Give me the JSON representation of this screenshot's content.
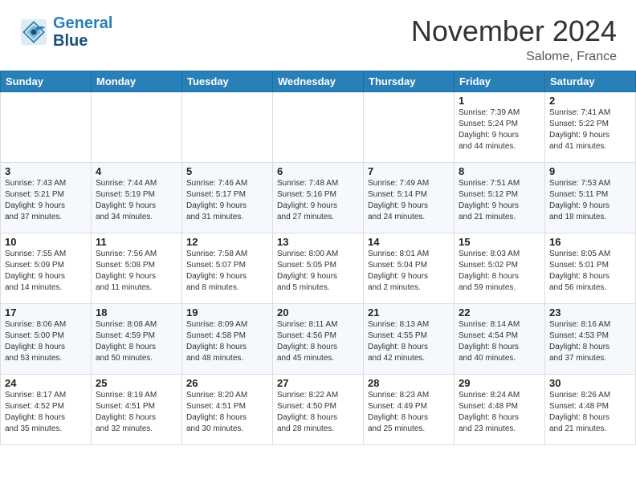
{
  "header": {
    "logo_line1": "General",
    "logo_line2": "Blue",
    "month": "November 2024",
    "location": "Salome, France"
  },
  "weekdays": [
    "Sunday",
    "Monday",
    "Tuesday",
    "Wednesday",
    "Thursday",
    "Friday",
    "Saturday"
  ],
  "weeks": [
    [
      {
        "day": "",
        "info": ""
      },
      {
        "day": "",
        "info": ""
      },
      {
        "day": "",
        "info": ""
      },
      {
        "day": "",
        "info": ""
      },
      {
        "day": "",
        "info": ""
      },
      {
        "day": "1",
        "info": "Sunrise: 7:39 AM\nSunset: 5:24 PM\nDaylight: 9 hours\nand 44 minutes."
      },
      {
        "day": "2",
        "info": "Sunrise: 7:41 AM\nSunset: 5:22 PM\nDaylight: 9 hours\nand 41 minutes."
      }
    ],
    [
      {
        "day": "3",
        "info": "Sunrise: 7:43 AM\nSunset: 5:21 PM\nDaylight: 9 hours\nand 37 minutes."
      },
      {
        "day": "4",
        "info": "Sunrise: 7:44 AM\nSunset: 5:19 PM\nDaylight: 9 hours\nand 34 minutes."
      },
      {
        "day": "5",
        "info": "Sunrise: 7:46 AM\nSunset: 5:17 PM\nDaylight: 9 hours\nand 31 minutes."
      },
      {
        "day": "6",
        "info": "Sunrise: 7:48 AM\nSunset: 5:16 PM\nDaylight: 9 hours\nand 27 minutes."
      },
      {
        "day": "7",
        "info": "Sunrise: 7:49 AM\nSunset: 5:14 PM\nDaylight: 9 hours\nand 24 minutes."
      },
      {
        "day": "8",
        "info": "Sunrise: 7:51 AM\nSunset: 5:12 PM\nDaylight: 9 hours\nand 21 minutes."
      },
      {
        "day": "9",
        "info": "Sunrise: 7:53 AM\nSunset: 5:11 PM\nDaylight: 9 hours\nand 18 minutes."
      }
    ],
    [
      {
        "day": "10",
        "info": "Sunrise: 7:55 AM\nSunset: 5:09 PM\nDaylight: 9 hours\nand 14 minutes."
      },
      {
        "day": "11",
        "info": "Sunrise: 7:56 AM\nSunset: 5:08 PM\nDaylight: 9 hours\nand 11 minutes."
      },
      {
        "day": "12",
        "info": "Sunrise: 7:58 AM\nSunset: 5:07 PM\nDaylight: 9 hours\nand 8 minutes."
      },
      {
        "day": "13",
        "info": "Sunrise: 8:00 AM\nSunset: 5:05 PM\nDaylight: 9 hours\nand 5 minutes."
      },
      {
        "day": "14",
        "info": "Sunrise: 8:01 AM\nSunset: 5:04 PM\nDaylight: 9 hours\nand 2 minutes."
      },
      {
        "day": "15",
        "info": "Sunrise: 8:03 AM\nSunset: 5:02 PM\nDaylight: 8 hours\nand 59 minutes."
      },
      {
        "day": "16",
        "info": "Sunrise: 8:05 AM\nSunset: 5:01 PM\nDaylight: 8 hours\nand 56 minutes."
      }
    ],
    [
      {
        "day": "17",
        "info": "Sunrise: 8:06 AM\nSunset: 5:00 PM\nDaylight: 8 hours\nand 53 minutes."
      },
      {
        "day": "18",
        "info": "Sunrise: 8:08 AM\nSunset: 4:59 PM\nDaylight: 8 hours\nand 50 minutes."
      },
      {
        "day": "19",
        "info": "Sunrise: 8:09 AM\nSunset: 4:58 PM\nDaylight: 8 hours\nand 48 minutes."
      },
      {
        "day": "20",
        "info": "Sunrise: 8:11 AM\nSunset: 4:56 PM\nDaylight: 8 hours\nand 45 minutes."
      },
      {
        "day": "21",
        "info": "Sunrise: 8:13 AM\nSunset: 4:55 PM\nDaylight: 8 hours\nand 42 minutes."
      },
      {
        "day": "22",
        "info": "Sunrise: 8:14 AM\nSunset: 4:54 PM\nDaylight: 8 hours\nand 40 minutes."
      },
      {
        "day": "23",
        "info": "Sunrise: 8:16 AM\nSunset: 4:53 PM\nDaylight: 8 hours\nand 37 minutes."
      }
    ],
    [
      {
        "day": "24",
        "info": "Sunrise: 8:17 AM\nSunset: 4:52 PM\nDaylight: 8 hours\nand 35 minutes."
      },
      {
        "day": "25",
        "info": "Sunrise: 8:19 AM\nSunset: 4:51 PM\nDaylight: 8 hours\nand 32 minutes."
      },
      {
        "day": "26",
        "info": "Sunrise: 8:20 AM\nSunset: 4:51 PM\nDaylight: 8 hours\nand 30 minutes."
      },
      {
        "day": "27",
        "info": "Sunrise: 8:22 AM\nSunset: 4:50 PM\nDaylight: 8 hours\nand 28 minutes."
      },
      {
        "day": "28",
        "info": "Sunrise: 8:23 AM\nSunset: 4:49 PM\nDaylight: 8 hours\nand 25 minutes."
      },
      {
        "day": "29",
        "info": "Sunrise: 8:24 AM\nSunset: 4:48 PM\nDaylight: 8 hours\nand 23 minutes."
      },
      {
        "day": "30",
        "info": "Sunrise: 8:26 AM\nSunset: 4:48 PM\nDaylight: 8 hours\nand 21 minutes."
      }
    ]
  ]
}
